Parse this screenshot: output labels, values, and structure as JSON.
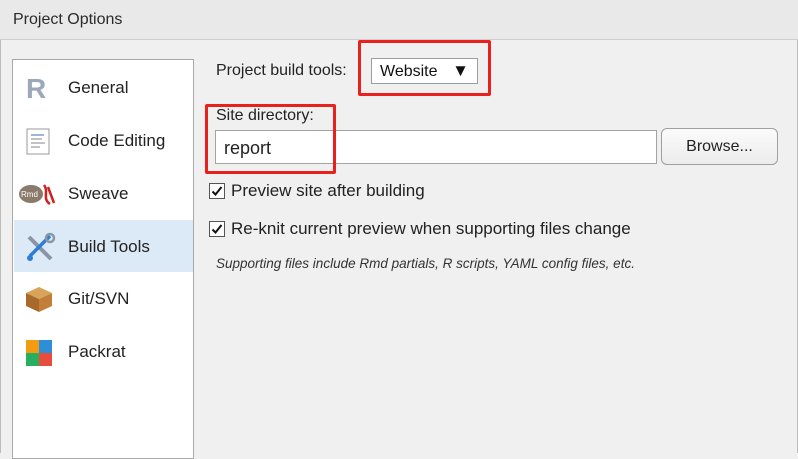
{
  "window": {
    "title": "Project Options"
  },
  "sidebar": {
    "items": [
      {
        "label": "General",
        "icon": "r-logo-icon"
      },
      {
        "label": "Code Editing",
        "icon": "code-document-icon"
      },
      {
        "label": "Sweave",
        "icon": "sweave-pdf-icon"
      },
      {
        "label": "Build Tools",
        "icon": "build-tools-icon",
        "selected": true
      },
      {
        "label": "Git/SVN",
        "icon": "git-box-icon"
      },
      {
        "label": "Packrat",
        "icon": "packrat-icon"
      }
    ]
  },
  "build_tools": {
    "project_build_tools_label": "Project build tools:",
    "build_tool_selected": "Website",
    "site_directory_label": "Site directory:",
    "site_directory_value": "report",
    "browse_label": "Browse...",
    "preview_site_label": "Preview site after building",
    "preview_site_checked": true,
    "reknit_label": "Re-knit current preview when supporting files change",
    "reknit_checked": true,
    "supporting_note": "Supporting files include Rmd partials, R scripts, YAML config files, etc."
  },
  "colors": {
    "highlight": "#e8211c",
    "selected_nav": "#dce9f6"
  }
}
